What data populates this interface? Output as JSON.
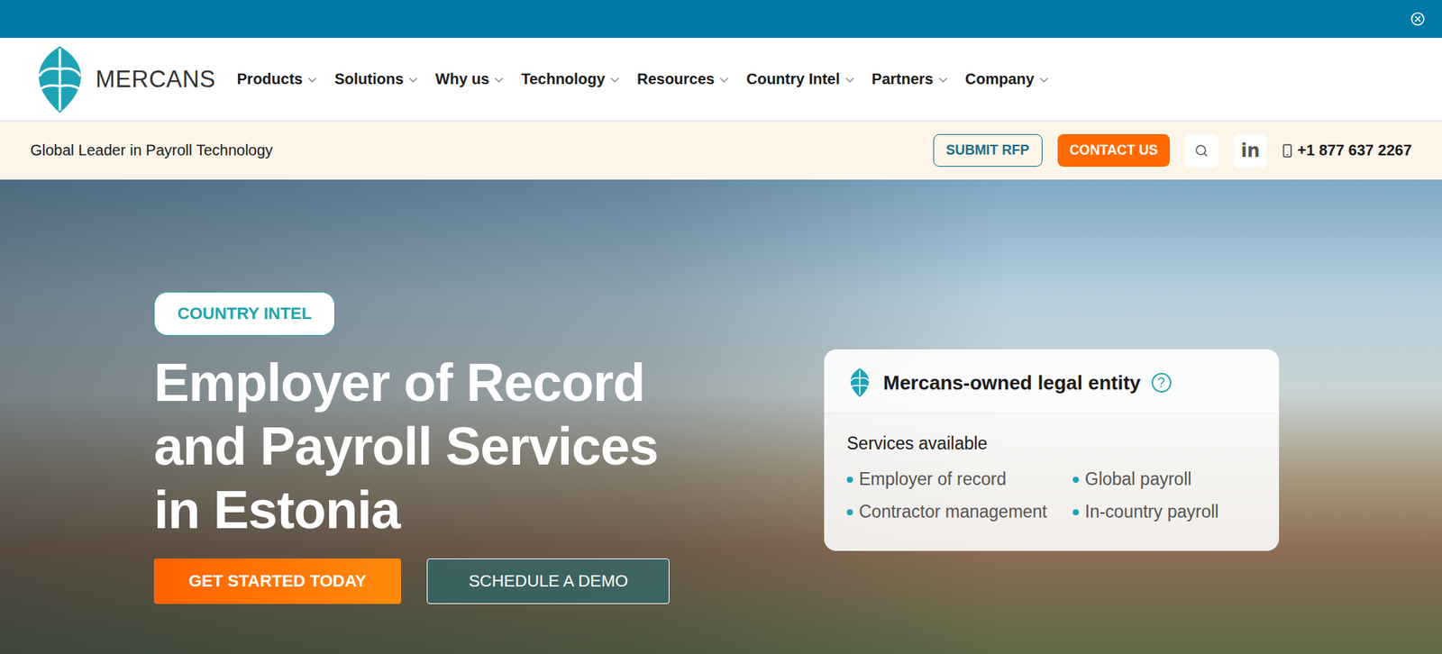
{
  "logo": {
    "text": "MERCANS"
  },
  "nav": [
    {
      "label": "Products"
    },
    {
      "label": "Solutions"
    },
    {
      "label": "Why us"
    },
    {
      "label": "Technology"
    },
    {
      "label": "Resources"
    },
    {
      "label": "Country Intel"
    },
    {
      "label": "Partners"
    },
    {
      "label": "Company"
    }
  ],
  "subbar": {
    "tagline": "Global Leader in Payroll Technology",
    "submit_rfp": "SUBMIT RFP",
    "contact_us": "CONTACT US",
    "linkedin": "in",
    "phone": "+1 877 637 2267"
  },
  "hero": {
    "badge": "COUNTRY INTEL",
    "title_lines": [
      "Employer of Record",
      "and Payroll Services",
      "in Estonia"
    ],
    "buttons": [
      "GET STARTED TODAY",
      "SCHEDULE A DEMO"
    ]
  },
  "entity_card": {
    "title": "Mercans-owned legal entity",
    "help": "?",
    "services_heading": "Services available",
    "services": [
      "Employer of record",
      "Global payroll",
      "Contractor management",
      "In-country payroll"
    ]
  }
}
